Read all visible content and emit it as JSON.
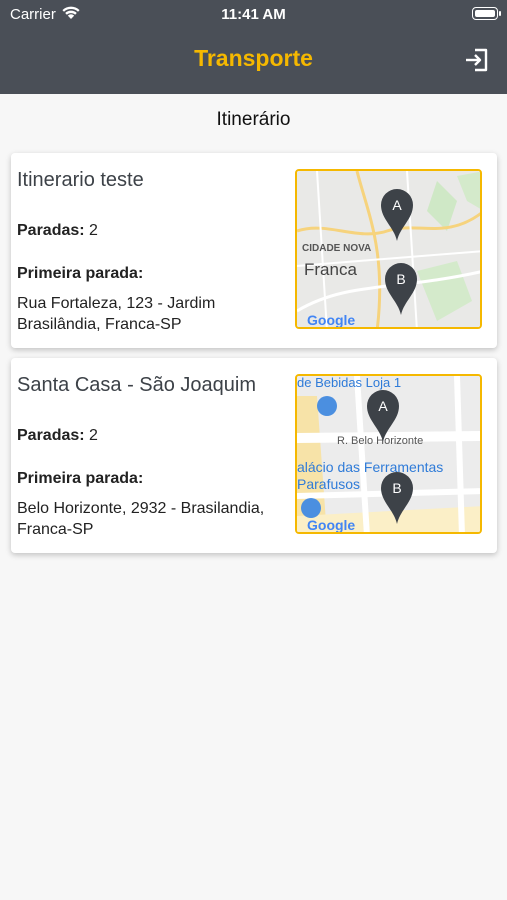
{
  "status_bar": {
    "carrier": "Carrier",
    "time": "11:41 AM"
  },
  "header": {
    "title": "Transporte"
  },
  "section_title": "Itinerário",
  "itineraries": [
    {
      "name": "Itinerario teste",
      "stops_label": "Paradas:",
      "stops_value": "2",
      "first_stop_label": "Primeira parada:",
      "first_stop_address": "Rua Fortaleza, 123 - Jardim Brasilândia, Franca-SP",
      "map": {
        "labels": [
          "CIDADE NOVA",
          "Franca"
        ],
        "markers": [
          "A",
          "B"
        ],
        "attribution": "Google"
      }
    },
    {
      "name": "Santa Casa - São Joaquim",
      "stops_label": "Paradas:",
      "stops_value": "2",
      "first_stop_label": "Primeira parada:",
      "first_stop_address": "Belo Horizonte, 2932 - Brasilandia, Franca-SP",
      "map": {
        "labels": [
          "de Bebidas Loja 1",
          "R. Belo Horizonte",
          "alácio das Ferramentas",
          "Parafusos"
        ],
        "markers": [
          "A",
          "B"
        ],
        "attribution": "Google"
      }
    }
  ],
  "colors": {
    "accent": "#f5b800",
    "header_bg": "#4a4f57",
    "marker": "#3d4248"
  }
}
